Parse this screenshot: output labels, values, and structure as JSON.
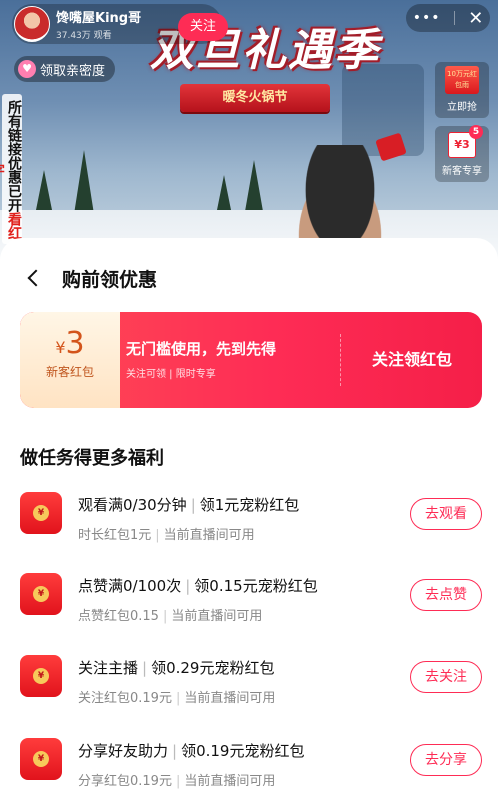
{
  "stream": {
    "host_name": "馋嘴屋King哥",
    "host_stats": "37.43万 观看",
    "follow_label": "关注",
    "banner_title": "双旦礼遇季",
    "banner_subtitle": "暖冬火锅节",
    "intimacy_label": "领取亲密度",
    "vertical_notice_black": "所有链接优惠已开",
    "vertical_notice_red": "看红字",
    "promo_card_1": {
      "envelope_text": "10万元红包雨",
      "label": "立即抢"
    },
    "promo_card_2": {
      "coupon_text": "¥3",
      "badge": "5",
      "label": "新客专享"
    }
  },
  "sheet": {
    "title": "购前领优惠",
    "coupon": {
      "currency": "¥",
      "amount": "3",
      "stub_label": "新客红包",
      "headline": "无门槛使用，先到先得",
      "sub_left": "关注可领",
      "sub_right": "限时专享",
      "cta": "关注领红包"
    },
    "tasks_title": "做任务得更多福利",
    "tasks": [
      {
        "title_left": "观看满0/30分钟",
        "title_right": "领1元宠粉红包",
        "desc_left": "时长红包1元",
        "desc_right": "当前直播间可用",
        "button": "去观看"
      },
      {
        "title_left": "点赞满0/100次",
        "title_right": "领0.15元宠粉红包",
        "desc_left": "点赞红包0.15",
        "desc_right": "当前直播间可用",
        "button": "去点赞"
      },
      {
        "title_left": "关注主播",
        "title_right": "领0.29元宠粉红包",
        "desc_left": "关注红包0.19元",
        "desc_right": "当前直播间可用",
        "button": "去关注"
      },
      {
        "title_left": "分享好友助力",
        "title_right": "领0.19元宠粉红包",
        "desc_left": "分享红包0.19元",
        "desc_right": "当前直播间可用",
        "button": "去分享"
      }
    ]
  },
  "colors": {
    "accent": "#fe2c55",
    "coupon_stub": "#fff1dc",
    "text_secondary": "#888888"
  }
}
